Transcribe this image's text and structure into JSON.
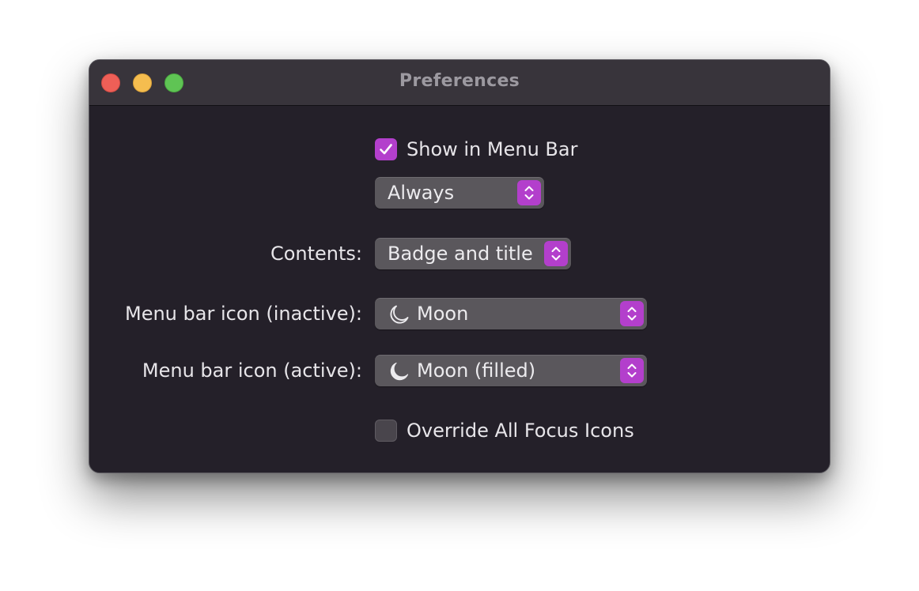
{
  "window": {
    "title": "Preferences"
  },
  "show_in_menu_bar": {
    "label": "Show in Menu Bar",
    "checked": true
  },
  "visibility_popup": {
    "value": "Always"
  },
  "contents": {
    "label": "Contents:",
    "value": "Badge and title"
  },
  "icon_inactive": {
    "label": "Menu bar icon (inactive):",
    "value": "Moon",
    "icon": "moon-outline-icon"
  },
  "icon_active": {
    "label": "Menu bar icon (active):",
    "value": "Moon (filled)",
    "icon": "moon-filled-icon"
  },
  "override_focus_icons": {
    "label": "Override All Focus Icons",
    "checked": false
  },
  "colors": {
    "accent": "#b33fcc",
    "window_bg": "#242029",
    "titlebar_bg": "#38343b",
    "close": "#ee5f57",
    "minimize": "#f5bd4f",
    "zoom": "#5fc454"
  }
}
